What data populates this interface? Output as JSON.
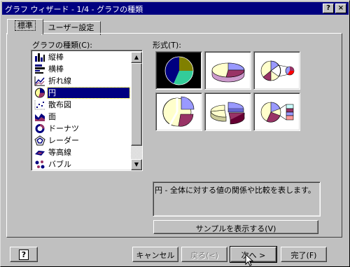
{
  "window": {
    "title": "グラフ ウィザード - 1/4 - グラフの種類",
    "help_label": "?",
    "close_label": "×"
  },
  "tabs": [
    {
      "label": "標準"
    },
    {
      "label": "ユーザー設定"
    }
  ],
  "chart_types": {
    "heading": "グラフの種類(C):",
    "items": [
      {
        "label": "縦棒",
        "icon": "column-chart-icon"
      },
      {
        "label": "横棒",
        "icon": "bar-chart-icon"
      },
      {
        "label": "折れ線",
        "icon": "line-chart-icon"
      },
      {
        "label": "円",
        "icon": "pie-chart-icon",
        "selected": true
      },
      {
        "label": "散布図",
        "icon": "scatter-chart-icon"
      },
      {
        "label": "面",
        "icon": "area-chart-icon"
      },
      {
        "label": "ドーナツ",
        "icon": "doughnut-chart-icon"
      },
      {
        "label": "レーダー",
        "icon": "radar-chart-icon"
      },
      {
        "label": "等高線",
        "icon": "surface-chart-icon"
      },
      {
        "label": "バブル",
        "icon": "bubble-chart-icon"
      }
    ]
  },
  "subtypes": {
    "heading": "形式(T):",
    "items": [
      {
        "name": "pie",
        "selected": true
      },
      {
        "name": "3d-pie"
      },
      {
        "name": "pie-of-pie"
      },
      {
        "name": "exploded-pie"
      },
      {
        "name": "exploded-3d-pie"
      },
      {
        "name": "bar-of-pie"
      }
    ]
  },
  "description": "円 - 全体に対する値の関係や比較を表します。",
  "sample_button": "サンプルを表示する(V)",
  "buttons": {
    "help": "?",
    "cancel": "キャンセル",
    "back": "戻る(<)",
    "next": "次へ >",
    "finish": "完了(F)"
  },
  "colors": {
    "titlebar": "#000080",
    "face": "#c0c0c0",
    "pie_blue": "#9999ff",
    "pie_plum": "#993366",
    "pie_cream": "#ffffcc",
    "pie_cyan": "#ccffff",
    "pie_olive": "#808000",
    "pie_teal": "#33cc99"
  }
}
